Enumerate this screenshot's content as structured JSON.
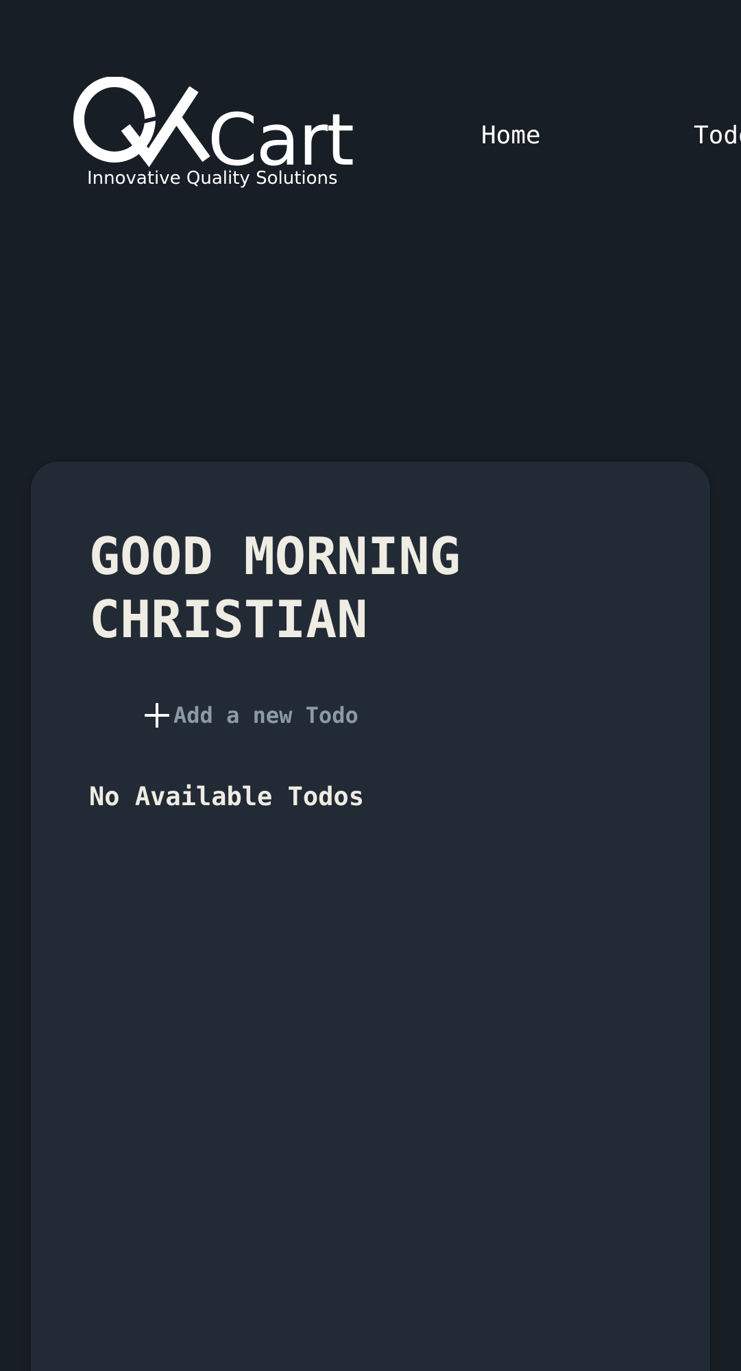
{
  "header": {
    "logo": {
      "wordmark": "QACart",
      "word_suffix": "Cart",
      "tagline": "Innovative Quality Solutions"
    },
    "nav": {
      "items": [
        {
          "label": "Home"
        },
        {
          "label": "Todos"
        }
      ]
    }
  },
  "main": {
    "greeting": "GOOD MORNING CHRISTIAN",
    "new_todo": {
      "icon": "plus-icon",
      "placeholder": "Add a new Todo",
      "value": ""
    },
    "empty_state": "No Available Todos"
  },
  "colors": {
    "page_background": "#181e25",
    "card_background": "#222b35",
    "heading_text": "#efece4",
    "placeholder_text": "#8c9aa8",
    "nav_text": "#ffffff"
  }
}
